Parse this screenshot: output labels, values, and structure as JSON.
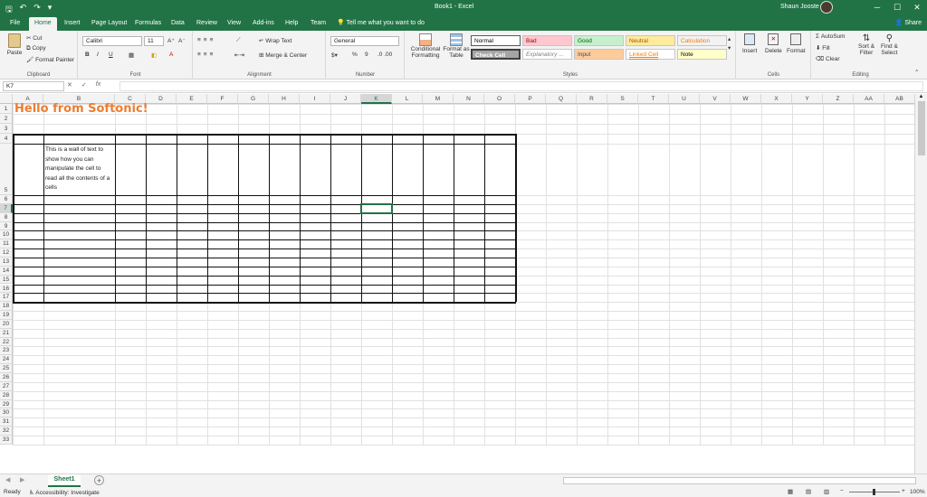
{
  "window": {
    "title": "Book1 - Excel",
    "user": "Shaun Jooste",
    "minimize": "─",
    "maximize": "☐",
    "close": "✕"
  },
  "quick_access": {
    "save": "🖫",
    "undo": "↶",
    "redo": "↷",
    "more": "▾"
  },
  "tabs": [
    {
      "label": "File"
    },
    {
      "label": "Home"
    },
    {
      "label": "Insert"
    },
    {
      "label": "Page Layout"
    },
    {
      "label": "Formulas"
    },
    {
      "label": "Data"
    },
    {
      "label": "Review"
    },
    {
      "label": "View"
    },
    {
      "label": "Add-ins"
    },
    {
      "label": "Help"
    },
    {
      "label": "Team"
    }
  ],
  "tell_me": "Tell me what you want to do",
  "share": "Share",
  "ribbon": {
    "clipboard": {
      "paste": "Paste",
      "cut": "Cut",
      "copy": "Copy",
      "format_painter": "Format Painter",
      "label": "Clipboard"
    },
    "font": {
      "name": "Calibri",
      "size": "11",
      "bold": "B",
      "italic": "I",
      "underline": "U",
      "label": "Font"
    },
    "alignment": {
      "wrap": "Wrap Text",
      "merge": "Merge & Center",
      "label": "Alignment"
    },
    "number": {
      "format": "General",
      "percent": "%",
      "comma": "9",
      "label": "Number"
    },
    "styles": {
      "conditional_1": "Conditional",
      "conditional_2": "Formatting",
      "format_table_1": "Format as",
      "format_table_2": "Table",
      "cells": [
        {
          "label": "Normal",
          "bg": "#ffffff",
          "fg": "#000000"
        },
        {
          "label": "Bad",
          "bg": "#ffc7ce",
          "fg": "#9c0006"
        },
        {
          "label": "Good",
          "bg": "#c6efce",
          "fg": "#006100"
        },
        {
          "label": "Neutral",
          "bg": "#ffeb9c",
          "fg": "#9c5700"
        },
        {
          "label": "Calculation",
          "bg": "#f2f2f2",
          "fg": "#fa7d00"
        },
        {
          "label": "Check Cell",
          "bg": "#a5a5a5",
          "fg": "#ffffff"
        },
        {
          "label": "Explanatory ...",
          "bg": "#ffffff",
          "fg": "#7f7f7f"
        },
        {
          "label": "Input",
          "bg": "#ffcc99",
          "fg": "#3f3f76"
        },
        {
          "label": "Linked Cell",
          "bg": "#ffffff",
          "fg": "#fa7d00"
        },
        {
          "label": "Note",
          "bg": "#ffffcc",
          "fg": "#000000"
        }
      ],
      "label": "Styles"
    },
    "cells": {
      "insert": "Insert",
      "delete": "Delete",
      "format": "Format",
      "label": "Cells"
    },
    "editing": {
      "autosum": "AutoSum",
      "fill": "Fill",
      "clear": "Clear",
      "sort_1": "Sort &",
      "sort_2": "Filter",
      "find_1": "Find &",
      "find_2": "Select",
      "label": "Editing"
    }
  },
  "formula_bar": {
    "name_box": "K7",
    "cancel": "✕",
    "enter": "✓",
    "fx": "fx",
    "value": ""
  },
  "columns": [
    "A",
    "B",
    "C",
    "D",
    "E",
    "F",
    "G",
    "H",
    "I",
    "J",
    "K",
    "L",
    "M",
    "N",
    "O",
    "P",
    "Q",
    "R",
    "S",
    "T",
    "U",
    "V",
    "W",
    "X",
    "Y",
    "Z",
    "AA",
    "AB"
  ],
  "rows": [
    "1",
    "2",
    "3",
    "4",
    "5",
    "6",
    "7",
    "8",
    "9",
    "10",
    "11",
    "12",
    "13",
    "14",
    "15",
    "16",
    "17",
    "18",
    "19",
    "20",
    "21",
    "22",
    "23",
    "24",
    "25",
    "26",
    "27",
    "28",
    "29",
    "30",
    "31",
    "32",
    "33"
  ],
  "selected": {
    "column": "K",
    "row": "7"
  },
  "cells": {
    "A1": "Hello from Softonic!",
    "B5": "This is a wall of text to show how you can manipulate the cell to read all the contents of a cells"
  },
  "sheet": {
    "name": "Sheet1",
    "add": "+"
  },
  "status": {
    "ready": "Ready",
    "accessibility": "Accessibility: Investigate",
    "zoom": "100%"
  }
}
